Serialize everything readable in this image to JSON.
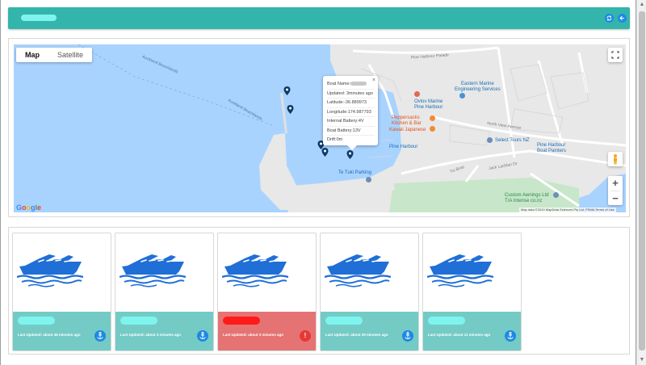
{
  "header": {
    "refresh_icon": "refresh-icon",
    "back_icon": "arrow-left-icon"
  },
  "map": {
    "type_options": [
      "Map",
      "Satellite"
    ],
    "selected_type": "Map",
    "fullscreen_icon": "fullscreen-icon",
    "zoom_in": "+",
    "zoom_out": "−",
    "logo": "Google",
    "attribution": "Map data ©2019 MapData Sciences Pty Ltd, PSMA   Terms of Use",
    "labels": {
      "auckland_beachlands_1": "Auckland Beachlands",
      "auckland_beachlands_2": "Auckland Beachlands",
      "pine_harbour_parade": "Pine Harbour Parade",
      "eastern_marine": "Eastern Marine\nEngineering Services",
      "ovlov_marine": "Ovlov Marine\nPine Harbour",
      "peppercorn": "Peppersacks\nKitchen & Bar",
      "kawaii_japanese": "Kawaii Japanese",
      "pine_harbour": "Pine Harbour",
      "select_tours": "Select Tours NZ",
      "pine_harbour_boat_painters": "Pine Harbour\nBoat Painters",
      "te_tuki_parking": "Te Tuki Parking",
      "custom_awnings": "Custom Awnings Ltd\nT/A Intense co.nz",
      "north_view_avenue": "North View Avenue",
      "jack_lachlan_dr": "Jack Lachlan Dr",
      "tui_brae": "Tui Brae"
    },
    "info_window": {
      "boat_name_label": "Boat Name:",
      "updated": "Updated: 3minutes ago",
      "latitude": "Latitude:-36.889973",
      "longitude": "Longitude:174.987793",
      "internal_battery": "Internal Battery:4V",
      "boat_battery": "Boat Battery:13V",
      "drift": "Drift:0m",
      "close": "×"
    }
  },
  "boats": [
    {
      "status": "Last Updated: about 46 minutes ago",
      "state": "ok",
      "action_icon": "anchor-icon"
    },
    {
      "status": "Last Updated: about 3 minutes ago",
      "state": "ok",
      "action_icon": "anchor-icon"
    },
    {
      "status": "Last Updated: about 3 minutes ago",
      "state": "alert",
      "action_icon": "alert-icon",
      "action_glyph": "!"
    },
    {
      "status": "Last Updated: about 29 minutes ago",
      "state": "ok",
      "action_icon": "anchor-icon"
    },
    {
      "status": "Last Updated: about 11 minutes ago",
      "state": "ok",
      "action_icon": "anchor-icon"
    }
  ],
  "colors": {
    "header": "#33b5ab",
    "card_ok": "#74cbc5",
    "card_alert": "#e57373",
    "accent": "#1e88e5",
    "water": "#a9d3ff"
  }
}
